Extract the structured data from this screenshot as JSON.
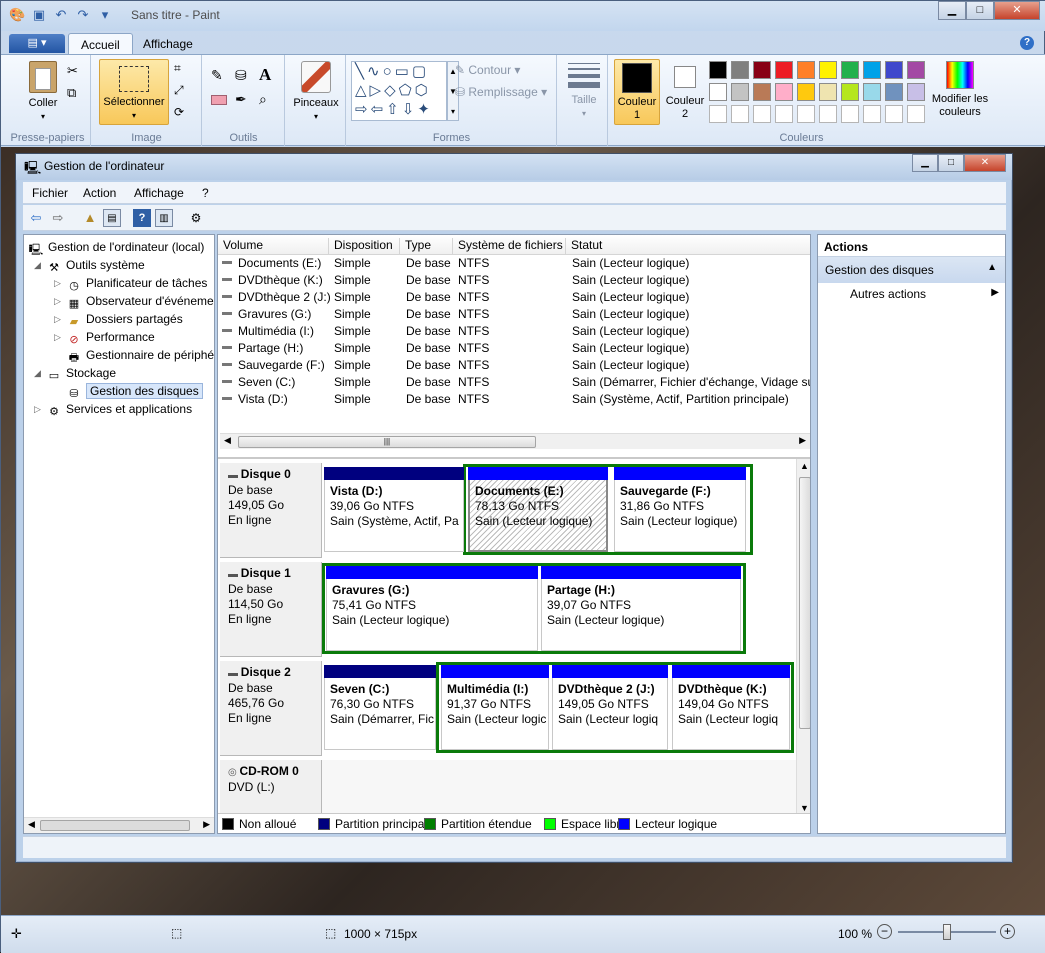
{
  "paint": {
    "title": "Sans titre - Paint",
    "tabs": [
      "Accueil",
      "Affichage"
    ],
    "groups": {
      "clipboard": {
        "label": "Presse-papiers",
        "paste": "Coller"
      },
      "image": {
        "label": "Image",
        "select": "Sélectionner"
      },
      "tools": {
        "label": "Outils"
      },
      "brushes": {
        "label": "Pinceaux"
      },
      "shapes": {
        "label": "Formes",
        "outline": "Contour",
        "fill": "Remplissage"
      },
      "size": {
        "label": "Taille"
      },
      "colors": {
        "label": "Couleurs",
        "color1_line1": "Couleur",
        "color1_line2": "1",
        "color2_line1": "Couleur",
        "color2_line2": "2",
        "edit_line1": "Modifier les",
        "edit_line2": "couleurs",
        "color1": "#000000",
        "color2": "#ffffff",
        "row1": [
          "#000000",
          "#7f7f7f",
          "#880015",
          "#ed1c24",
          "#ff7f27",
          "#fff200",
          "#22b14c",
          "#00a2e8",
          "#3f48cc",
          "#a349a4"
        ],
        "row2": [
          "#ffffff",
          "#c3c3c3",
          "#b97a57",
          "#ffaec9",
          "#ffc90e",
          "#efe4b0",
          "#b5e61d",
          "#99d9ea",
          "#7092be",
          "#c8bfe7"
        ]
      }
    },
    "status": {
      "dimensions": "1000 × 715px",
      "zoom": "100 %",
      "zoom_level_percent": 100
    }
  },
  "mmc": {
    "title": "Gestion de l'ordinateur",
    "menu": [
      "Fichier",
      "Action",
      "Affichage",
      "?"
    ],
    "tree": {
      "root": "Gestion de l'ordinateur (local)",
      "system_tools": "Outils système",
      "task_scheduler": "Planificateur de tâches",
      "event_viewer": "Observateur d'événeme",
      "shared_folders": "Dossiers partagés",
      "performance": "Performance",
      "device_manager": "Gestionnaire de périphé",
      "storage": "Stockage",
      "disk_management": "Gestion des disques",
      "services": "Services et applications"
    },
    "columns": [
      "Volume",
      "Disposition",
      "Type",
      "Système de fichiers",
      "Statut"
    ],
    "volumes": [
      {
        "name": "Documents (E:)",
        "layout": "Simple",
        "type": "De base",
        "fs": "NTFS",
        "status": "Sain (Lecteur logique)"
      },
      {
        "name": "DVDthèque (K:)",
        "layout": "Simple",
        "type": "De base",
        "fs": "NTFS",
        "status": "Sain (Lecteur logique)"
      },
      {
        "name": "DVDthèque 2 (J:)",
        "layout": "Simple",
        "type": "De base",
        "fs": "NTFS",
        "status": "Sain (Lecteur logique)"
      },
      {
        "name": "Gravures (G:)",
        "layout": "Simple",
        "type": "De base",
        "fs": "NTFS",
        "status": "Sain (Lecteur logique)"
      },
      {
        "name": "Multimédia (I:)",
        "layout": "Simple",
        "type": "De base",
        "fs": "NTFS",
        "status": "Sain (Lecteur logique)"
      },
      {
        "name": "Partage (H:)",
        "layout": "Simple",
        "type": "De base",
        "fs": "NTFS",
        "status": "Sain (Lecteur logique)"
      },
      {
        "name": "Sauvegarde (F:)",
        "layout": "Simple",
        "type": "De base",
        "fs": "NTFS",
        "status": "Sain (Lecteur logique)"
      },
      {
        "name": "Seven (C:)",
        "layout": "Simple",
        "type": "De base",
        "fs": "NTFS",
        "status": "Sain (Démarrer, Fichier d'échange, Vidage sur"
      },
      {
        "name": "Vista (D:)",
        "layout": "Simple",
        "type": "De base",
        "fs": "NTFS",
        "status": "Sain (Système, Actif, Partition principale)"
      }
    ],
    "disks": [
      {
        "name": "Disque 0",
        "type": "De base",
        "size": "149,05 Go",
        "state": "En ligne",
        "parts": [
          {
            "name": "Vista  (D:)",
            "size": "39,06 Go NTFS",
            "status": "Sain (Système, Actif, Pa"
          },
          {
            "name": "Documents  (E:)",
            "size": "78,13 Go NTFS",
            "status": "Sain (Lecteur logique)"
          },
          {
            "name": "Sauvegarde  (F:)",
            "size": "31,86 Go NTFS",
            "status": "Sain (Lecteur logique)"
          }
        ]
      },
      {
        "name": "Disque 1",
        "type": "De base",
        "size": "114,50 Go",
        "state": "En ligne",
        "parts": [
          {
            "name": "Gravures  (G:)",
            "size": "75,41 Go NTFS",
            "status": "Sain (Lecteur logique)"
          },
          {
            "name": "Partage  (H:)",
            "size": "39,07 Go NTFS",
            "status": "Sain (Lecteur logique)"
          }
        ]
      },
      {
        "name": "Disque 2",
        "type": "De base",
        "size": "465,76 Go",
        "state": "En ligne",
        "parts": [
          {
            "name": "Seven  (C:)",
            "size": "76,30 Go NTFS",
            "status": "Sain (Démarrer, Fic"
          },
          {
            "name": "Multimédia  (I:)",
            "size": "91,37 Go NTFS",
            "status": "Sain (Lecteur logic"
          },
          {
            "name": "DVDthèque 2  (J:)",
            "size": "149,05 Go NTFS",
            "status": "Sain (Lecteur logiq"
          },
          {
            "name": "DVDthèque  (K:)",
            "size": "149,04 Go NTFS",
            "status": "Sain (Lecteur logiq"
          }
        ]
      },
      {
        "name": "CD-ROM 0",
        "type": "DVD (L:)"
      }
    ],
    "legend": [
      {
        "label": "Non alloué",
        "color": "#000000"
      },
      {
        "label": "Partition principale",
        "color": "#00007f"
      },
      {
        "label": "Partition étendue",
        "color": "#007f00"
      },
      {
        "label": "Espace libre",
        "color": "#00ff00"
      },
      {
        "label": "Lecteur logique",
        "color": "#0000ff"
      }
    ],
    "actions": {
      "title": "Actions",
      "section": "Gestion des disques",
      "more": "Autres actions"
    }
  }
}
